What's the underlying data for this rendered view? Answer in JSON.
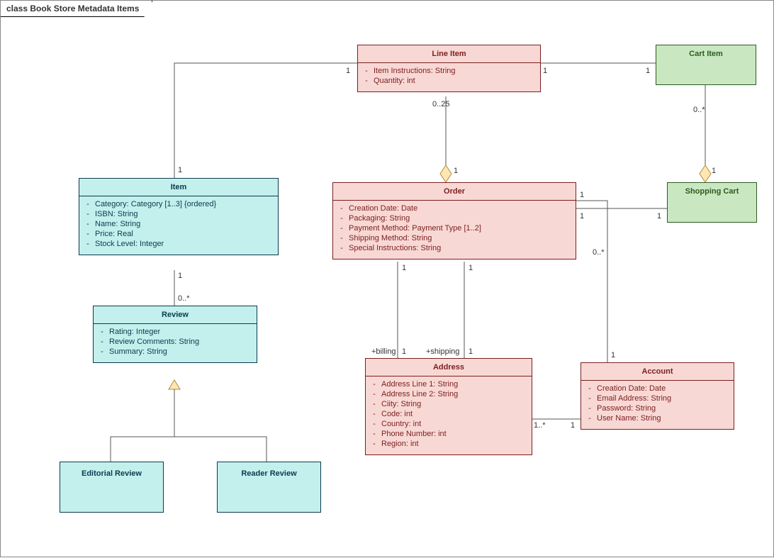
{
  "title": "class Book Store Metadata Items",
  "classes": {
    "lineItem": {
      "name": "Line Item",
      "attrs": [
        "Item Instructions: String",
        "Quantity: int"
      ]
    },
    "cartItem": {
      "name": "Cart Item",
      "attrs": []
    },
    "shoppingCart": {
      "name": "Shopping Cart",
      "attrs": []
    },
    "item": {
      "name": "Item",
      "attrs": [
        "Category: Category [1..3] {ordered}",
        "ISBN: String",
        "Name: String",
        "Price: Real",
        "Stock Level: Integer"
      ]
    },
    "order": {
      "name": "Order",
      "attrs": [
        "Creation Date: Date",
        "Packaging: String",
        "Payment Method: Payment Type [1..2]",
        "Shipping Method: String",
        "Special Instructions: String"
      ]
    },
    "review": {
      "name": "Review",
      "attrs": [
        "Rating: Integer",
        "Review Comments: String",
        "Summary: String"
      ]
    },
    "editorialReview": {
      "name": "Editorial Review",
      "attrs": []
    },
    "readerReview": {
      "name": "Reader Review",
      "attrs": []
    },
    "address": {
      "name": "Address",
      "attrs": [
        "Address Line 1: String",
        "Address Line 2: String",
        "Ciity: String",
        "Code: int",
        "Country: int",
        "Phone Number: int",
        "Region: int"
      ]
    },
    "account": {
      "name": "Account",
      "attrs": [
        "Creation Date: Date",
        "Email Address: String",
        "Password: String",
        "User Name: String"
      ]
    }
  },
  "mults": {
    "li_item_li": "1",
    "li_item_item": "1",
    "li_cart_li": "1",
    "li_cart_cart": "1",
    "li_order_li": "0..25",
    "li_order_order": "1",
    "cart_sc_cart": "0..*",
    "cart_sc_sc": "1",
    "item_review_item": "1",
    "item_review_review": "0..*",
    "order_account_order": "1",
    "order_account_account": "0..*",
    "order_sc_order": "1",
    "order_sc_sc": "1",
    "order_billing_order": "1",
    "order_billing_addr": "1",
    "order_billing_role": "+billing",
    "order_shipping_order": "1",
    "order_shipping_addr": "1",
    "order_shipping_role": "+shipping",
    "addr_account_addr": "1..*",
    "addr_account_account": "1"
  }
}
